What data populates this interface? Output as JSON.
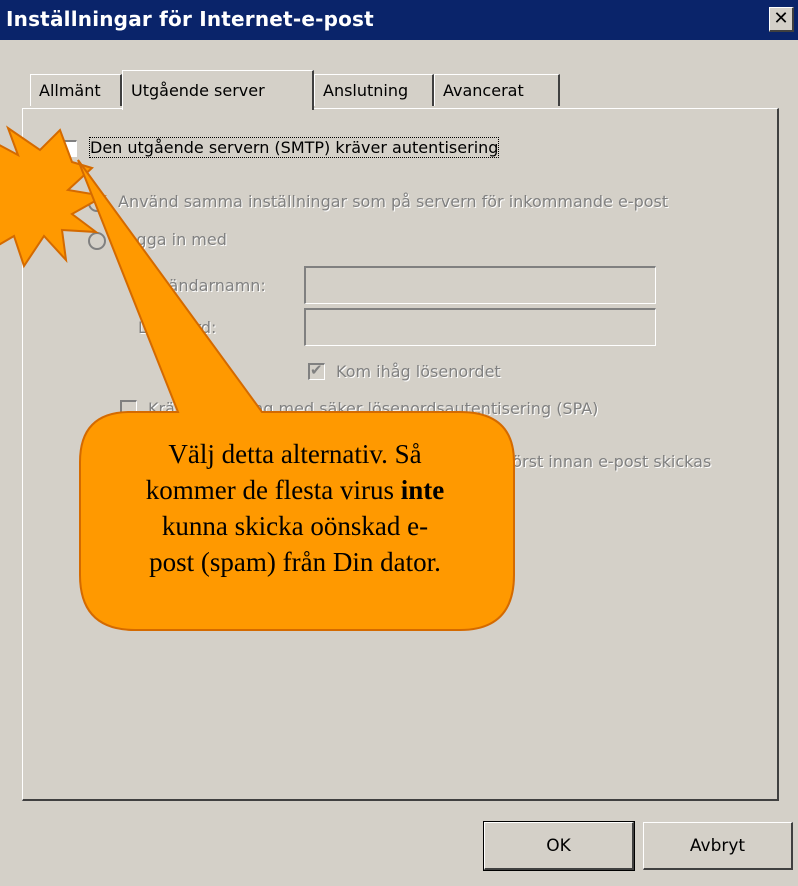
{
  "window": {
    "title": "Inställningar för Internet-e-post",
    "close_glyph": "✕"
  },
  "tabs": [
    {
      "label": "Allmänt"
    },
    {
      "label": "Utgående server",
      "active": true
    },
    {
      "label": "Anslutning"
    },
    {
      "label": "Avancerat"
    }
  ],
  "outgoing": {
    "smtp_auth_label": "Den utgående servern (SMTP) kräver autentisering",
    "smtp_auth_checked": false,
    "use_same_label": "Använd samma inställningar som på servern för inkommande e-post",
    "login_with_label": "Logga in med",
    "username_label": "Användarnamn:",
    "password_label": "Lösenord:",
    "remember_password_label": "Kom ihåg lösenordet",
    "remember_password_checked": true,
    "spa_label": "Kräv inloggning med säker lösenordsautentisering (SPA)",
    "login_before_label": "Logga in på den inkommande e-postservern först innan e-post skickas"
  },
  "callout": {
    "line1": "Välj detta alternativ. Så",
    "line2_pre": "kommer de flesta virus ",
    "line2_bold": "inte",
    "line3": "kunna skicka oönskad e-",
    "line4": "post (spam) från Din dator.",
    "fill_color": "#ff9900",
    "stroke_color": "#d46a00",
    "starburst_icon": "starburst-icon"
  },
  "buttons": {
    "ok_label": "OK",
    "cancel_label": "Avbryt"
  }
}
